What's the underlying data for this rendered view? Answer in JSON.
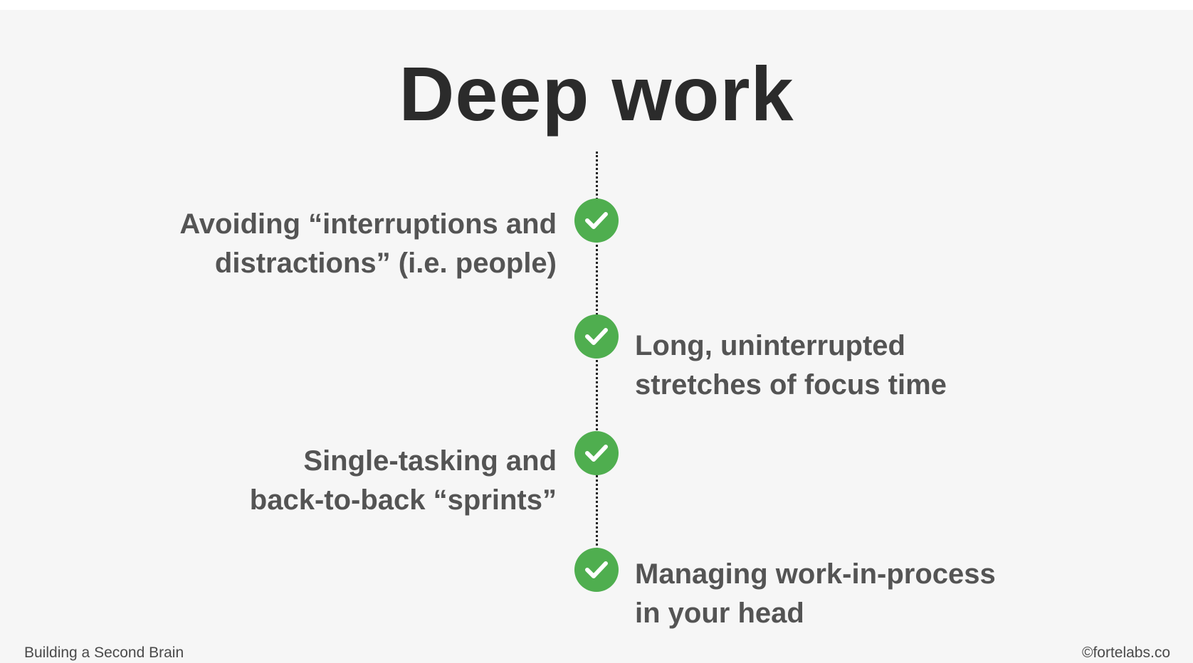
{
  "slide": {
    "title": "Deep work",
    "items": [
      {
        "side": "left",
        "lines": [
          "Avoiding “interruptions and",
          "distractions” (i.e. people)"
        ]
      },
      {
        "side": "right",
        "lines": [
          "Long, uninterrupted",
          "stretches of focus time"
        ]
      },
      {
        "side": "left",
        "lines": [
          "Single-tasking and",
          "back-to-back “sprints”"
        ]
      },
      {
        "side": "right",
        "lines": [
          "Managing work-in-process",
          "in your head"
        ]
      }
    ],
    "icon": "check-circle-icon",
    "accent_color": "#4fae4f"
  },
  "footer": {
    "left": "Building a Second Brain",
    "right": "©fortelabs.co"
  }
}
